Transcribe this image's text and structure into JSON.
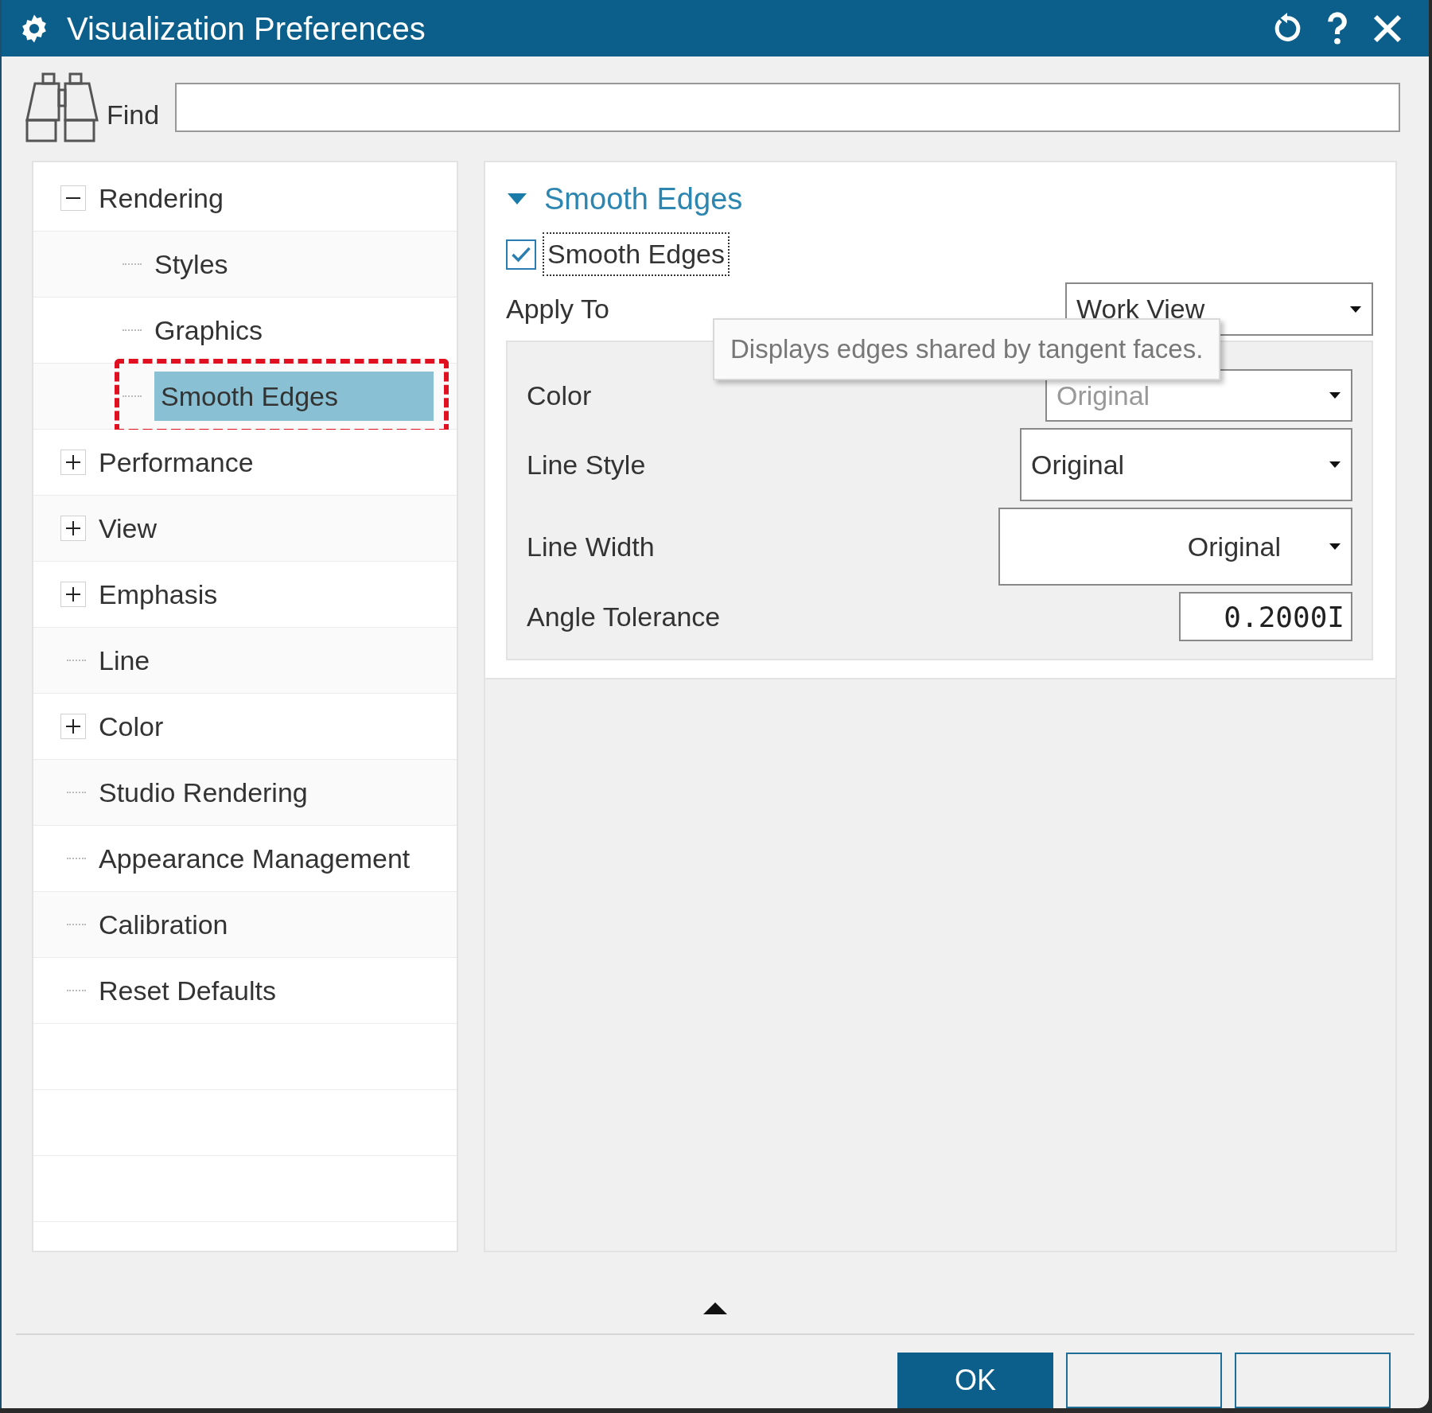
{
  "window": {
    "title": "Visualization Preferences"
  },
  "find": {
    "label": "Find"
  },
  "tree": [
    {
      "label": "Rendering",
      "expanded": true,
      "selected": false,
      "children": [
        {
          "label": "Styles",
          "selected": false
        },
        {
          "label": "Graphics",
          "selected": false
        },
        {
          "label": "Smooth Edges",
          "selected": true,
          "annotated": true
        }
      ]
    },
    {
      "label": "Performance",
      "expanded": false,
      "selected": false
    },
    {
      "label": "View",
      "expanded": false,
      "selected": false
    },
    {
      "label": "Emphasis",
      "expanded": false,
      "selected": false
    },
    {
      "label": "Line",
      "selected": false
    },
    {
      "label": "Color",
      "expanded": false,
      "selected": false
    },
    {
      "label": "Studio Rendering",
      "selected": false
    },
    {
      "label": "Appearance Management",
      "selected": false
    },
    {
      "label": "Calibration",
      "selected": false
    },
    {
      "label": "Reset Defaults",
      "selected": false
    }
  ],
  "section": {
    "title": "Smooth Edges",
    "expanded": true,
    "checkbox": {
      "label": "Smooth Edges",
      "checked": true
    },
    "apply_to": {
      "label": "Apply To",
      "value": "Work View"
    },
    "fields": [
      {
        "kind": "dropdown",
        "label": "Color",
        "value": "Original"
      },
      {
        "kind": "dropdown",
        "label": "Line Style",
        "value": "Original"
      },
      {
        "kind": "dropdown",
        "label": "Line Width",
        "value": "Original"
      },
      {
        "kind": "number",
        "label": "Angle Tolerance",
        "value": "0.2000I"
      }
    ],
    "tooltip": "Displays edges shared by tangent faces."
  },
  "buttons": [
    {
      "label": "OK",
      "kind": "primary"
    },
    {
      "kind": "secondary"
    },
    {
      "kind": "secondary"
    }
  ]
}
